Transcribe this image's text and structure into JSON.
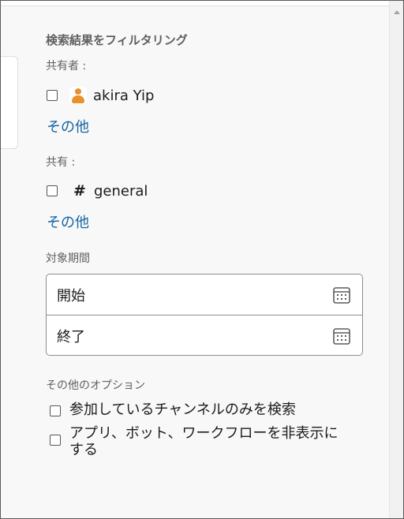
{
  "filter": {
    "heading": "検索結果をフィルタリング",
    "shared_by": {
      "label": "共有者 :",
      "items": [
        {
          "name": "akira Yip",
          "icon": "user-avatar-icon",
          "checked": false
        }
      ],
      "more": "その他"
    },
    "shared_in": {
      "label": "共有 :",
      "items": [
        {
          "name": "general",
          "icon": "hash-icon",
          "checked": false
        }
      ],
      "more": "その他"
    },
    "date_range": {
      "label": "対象期間",
      "start_placeholder": "開始",
      "end_placeholder": "終了",
      "icon": "calendar-icon"
    },
    "other_options": {
      "label": "その他のオプション",
      "items": [
        {
          "label": "参加しているチャンネルのみを検索",
          "checked": false
        },
        {
          "label": "アプリ、ボット、ワークフローを非表示にする",
          "checked": false
        }
      ]
    }
  },
  "colors": {
    "link": "#1264a3",
    "avatar": "#e8912d",
    "label": "#616061",
    "text": "#1d1c1d",
    "panel": "#f8f8f8"
  }
}
